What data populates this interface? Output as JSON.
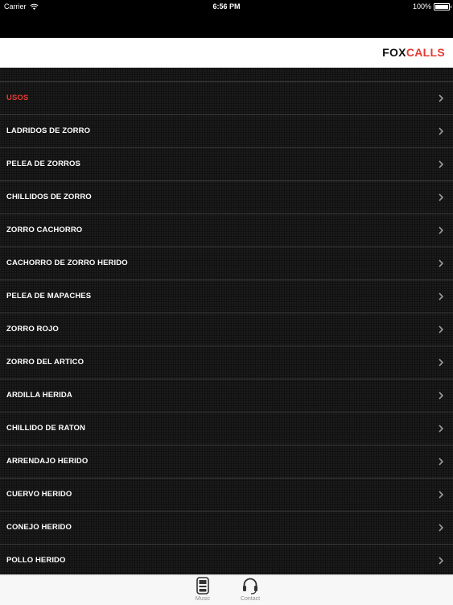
{
  "status_bar": {
    "carrier": "Carrier",
    "time": "6:56 PM",
    "battery": "100%",
    "battery_level": 1.0
  },
  "header": {
    "logo_part1": "FOX",
    "logo_part2": "CALLS",
    "accent_color": "#e53a32"
  },
  "menu": {
    "items": [
      {
        "label": "USOS",
        "accent": true
      },
      {
        "label": "LADRIDOS DE ZORRO"
      },
      {
        "label": "PELEA DE ZORROS"
      },
      {
        "label": "CHILLIDOS DE ZORRO"
      },
      {
        "label": "ZORRO CACHORRO"
      },
      {
        "label": "CACHORRO DE ZORRO HERIDO"
      },
      {
        "label": "PELEA DE MAPACHES"
      },
      {
        "label": "ZORRO ROJO"
      },
      {
        "label": "ZORRO DEL ARTICO"
      },
      {
        "label": "ARDILLA HERIDA"
      },
      {
        "label": "CHILLIDO DE RATON"
      },
      {
        "label": "ARRENDAJO HERIDO"
      },
      {
        "label": "CUERVO HERIDO"
      },
      {
        "label": "CONEJO HERIDO"
      },
      {
        "label": "POLLO HERIDO"
      }
    ]
  },
  "tabbar": {
    "tabs": [
      {
        "label": "Music",
        "icon": "jukebox-icon",
        "selected": true
      },
      {
        "label": "Contact",
        "icon": "headset-icon",
        "selected": false
      }
    ]
  }
}
